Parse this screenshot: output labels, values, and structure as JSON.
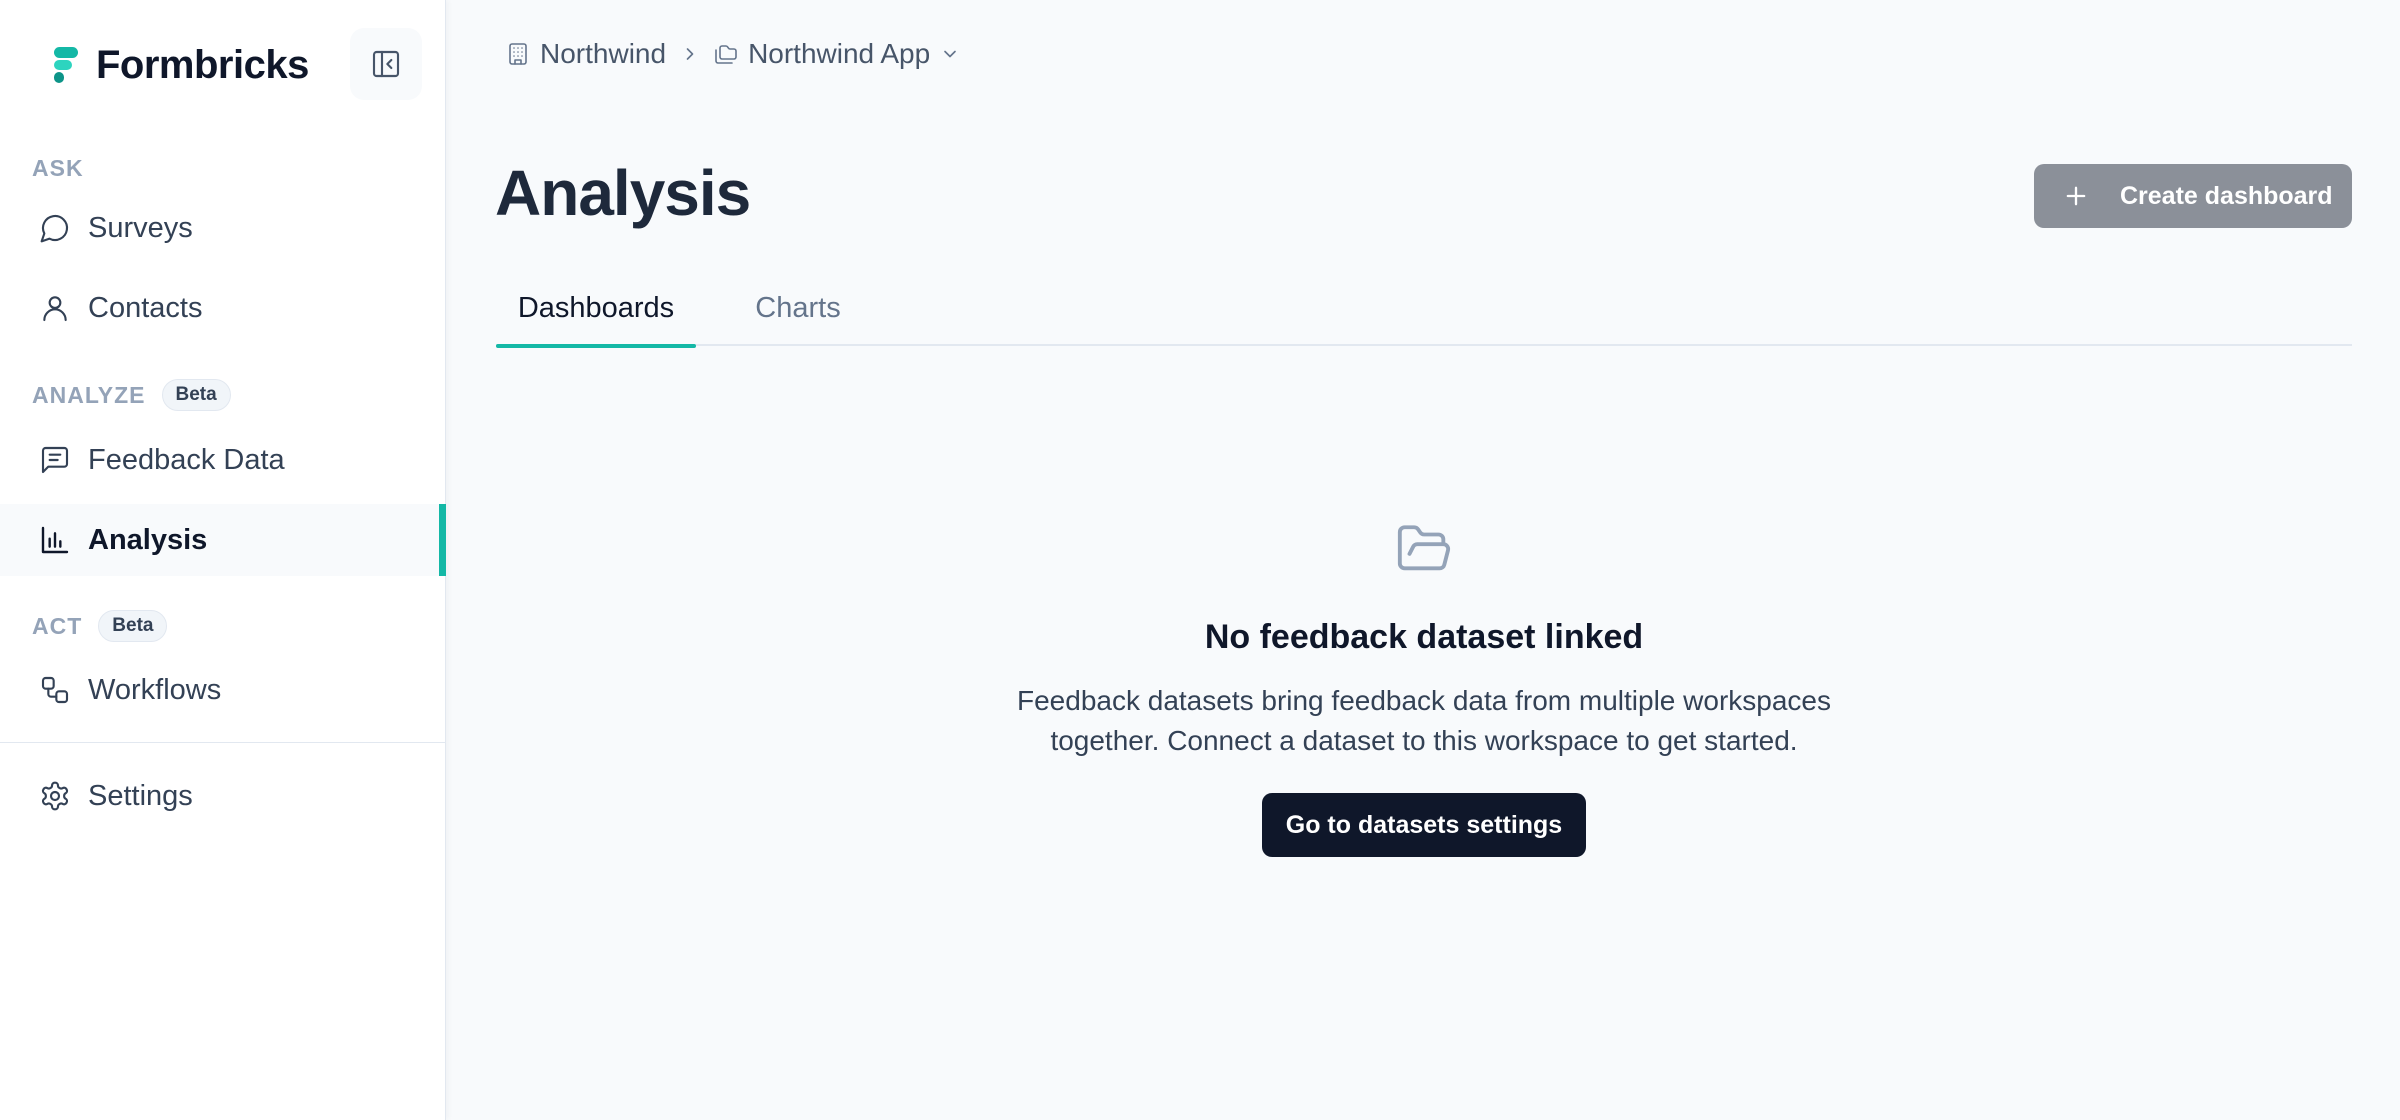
{
  "brand": {
    "name": "Formbricks",
    "accent_color": "#14b8a6"
  },
  "sidebar": {
    "sections": {
      "ask": "ASK",
      "analyze": "ANALYZE",
      "analyze_badge": "Beta",
      "act": "ACT",
      "act_badge": "Beta"
    },
    "items": [
      {
        "label": "Surveys",
        "icon": "message-circle-icon",
        "active": false
      },
      {
        "label": "Contacts",
        "icon": "user-icon",
        "active": false
      },
      {
        "label": "Feedback Data",
        "icon": "message-square-text-icon",
        "active": false
      },
      {
        "label": "Analysis",
        "icon": "bar-chart-icon",
        "active": true
      },
      {
        "label": "Workflows",
        "icon": "workflow-icon",
        "active": false
      },
      {
        "label": "Settings",
        "icon": "gear-icon",
        "active": false
      }
    ]
  },
  "breadcrumb": {
    "organization": "Northwind",
    "workspace": "Northwind App"
  },
  "main": {
    "title": "Analysis",
    "create_button": "Create dashboard",
    "tabs": [
      {
        "label": "Dashboards",
        "active": true
      },
      {
        "label": "Charts",
        "active": false
      }
    ],
    "empty_state": {
      "icon": "folder-open-icon",
      "title": "No feedback dataset linked",
      "description": "Feedback datasets bring feedback data from multiple workspaces together. Connect a dataset to this workspace to get started.",
      "button": "Go to datasets settings"
    }
  }
}
